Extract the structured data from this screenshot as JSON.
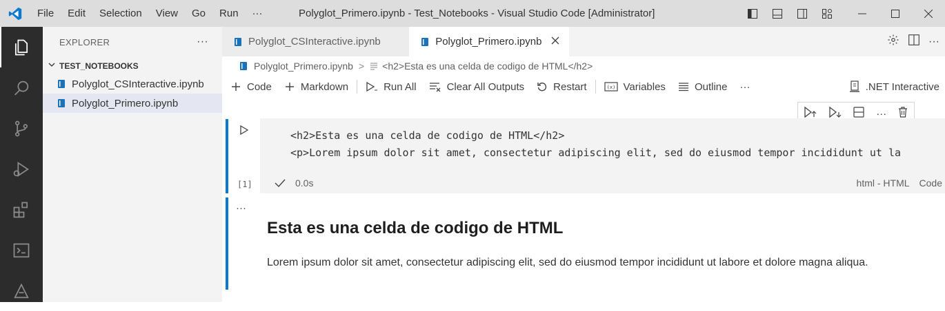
{
  "menu": [
    "File",
    "Edit",
    "Selection",
    "View",
    "Go",
    "Run",
    "···"
  ],
  "window_title": "Polyglot_Primero.ipynb - Test_Notebooks - Visual Studio Code [Administrator]",
  "activity_icons": [
    "explorer-icon",
    "search-icon",
    "source-control-icon",
    "run-debug-icon",
    "extensions-icon",
    "terminal-icon",
    "polyglot-icon"
  ],
  "sidebar": {
    "title": "EXPLORER",
    "more": "···",
    "section": "TEST_NOTEBOOKS",
    "files": [
      {
        "label": "Polyglot_CSInteractive.ipynb"
      },
      {
        "label": "Polyglot_Primero.ipynb"
      }
    ]
  },
  "tabs": [
    {
      "label": "Polyglot_CSInteractive.ipynb"
    },
    {
      "label": "Polyglot_Primero.ipynb"
    }
  ],
  "breadcrumbs": {
    "file": "Polyglot_Primero.ipynb",
    "sep": ">",
    "symbol": "<h2>Esta es una celda de codigo de HTML</h2>"
  },
  "toolbar": {
    "code": "Code",
    "markdown": "Markdown",
    "run_all": "Run All",
    "clear_outputs": "Clear All Outputs",
    "restart": "Restart",
    "variables": "Variables",
    "outline": "Outline",
    "more": "···",
    "kernel": ".NET Interactive"
  },
  "cell1": {
    "lines": [
      "<h2>Esta es una celda de codigo de HTML</h2>",
      "<p>Lorem ipsum dolor sit amet, consectetur adipiscing elit, sed do eiusmod tempor incididunt ut la"
    ],
    "exec_count": "[1]",
    "duration": "0.0s",
    "language": "html - HTML",
    "cell_type": "Code"
  },
  "cell2": {
    "dots": "···",
    "heading": "Esta es una celda de codigo de HTML",
    "paragraph": "Lorem ipsum dolor sit amet, consectetur adipiscing elit, sed do eiusmod tempor incididunt ut labore et dolore magna aliqua."
  },
  "colors": {
    "accent": "#0b7ad1",
    "vscode_blue": "#0078d4"
  }
}
